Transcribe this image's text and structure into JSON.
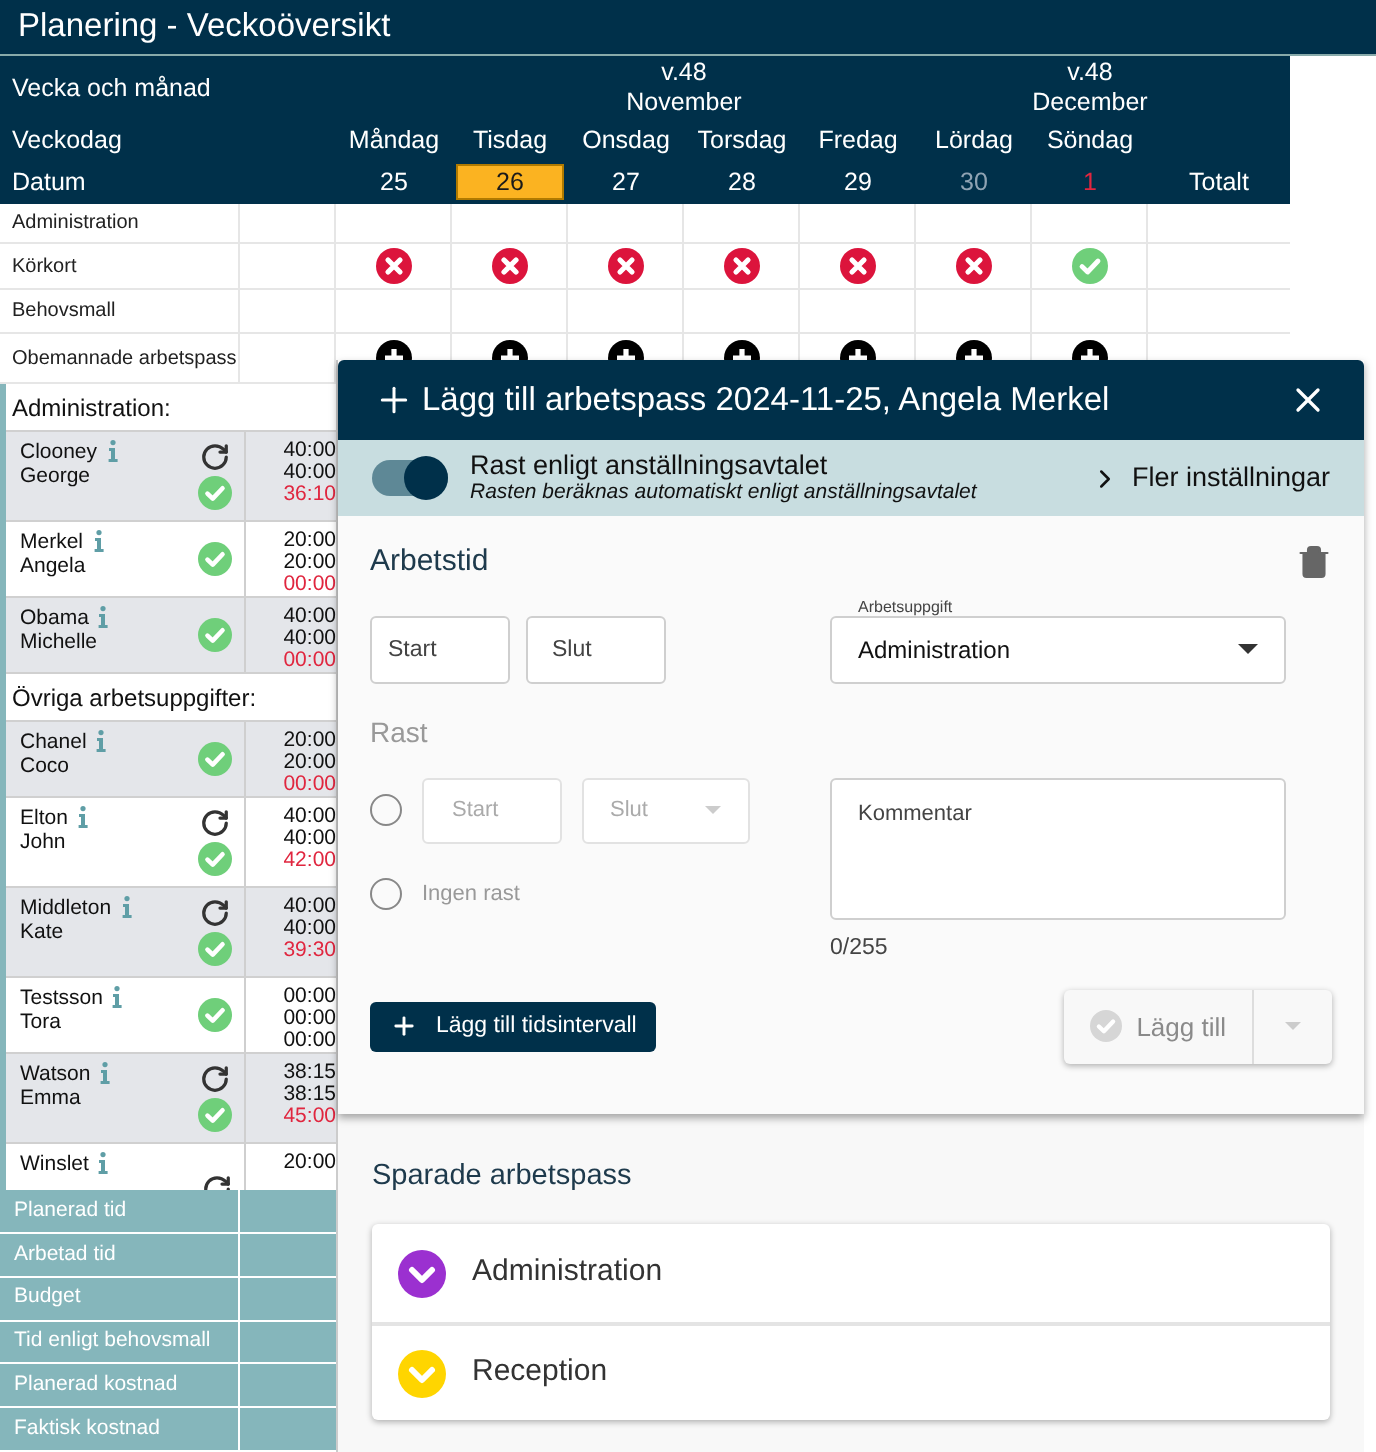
{
  "title": "Planering - Veckoöversikt",
  "table": {
    "header_labels": [
      "Vecka och månad",
      "Veckodag",
      "Datum"
    ],
    "total_label": "Totalt",
    "month_groups": [
      {
        "week": "v.48",
        "month": "November",
        "days": [
          {
            "name": "Måndag",
            "date": "25",
            "kind": "weekday",
            "selected": false
          },
          {
            "name": "Tisdag",
            "date": "26",
            "kind": "weekday",
            "selected": true
          },
          {
            "name": "Onsdag",
            "date": "27",
            "kind": "weekday",
            "selected": false
          },
          {
            "name": "Torsdag",
            "date": "28",
            "kind": "weekday",
            "selected": false
          },
          {
            "name": "Fredag",
            "date": "29",
            "kind": "weekday",
            "selected": false
          },
          {
            "name": "Lördag",
            "date": "30",
            "kind": "saturday",
            "selected": false
          }
        ]
      },
      {
        "week": "v.48",
        "month": "December",
        "days": [
          {
            "name": "Söndag",
            "date": "1",
            "kind": "sunday",
            "selected": false
          }
        ]
      }
    ],
    "summary_rows": [
      {
        "label": "Administration",
        "kind": "empty"
      },
      {
        "label": "Körkort",
        "kind": "status",
        "cells": [
          {
            "ok": false
          },
          {
            "ok": false
          },
          {
            "ok": false
          },
          {
            "ok": false
          },
          {
            "ok": false
          },
          {
            "ok": false
          },
          {
            "ok": true
          }
        ]
      },
      {
        "label": "Behovsmall",
        "kind": "empty"
      },
      {
        "label": "Obemannade arbetspass",
        "kind": "add"
      }
    ],
    "sections": [
      {
        "title": "Administration:",
        "employees": [
          {
            "last": "Clooney",
            "first": "George",
            "repeat": true,
            "approved": true,
            "hours": [
              "40:00",
              "40:00",
              "36:10"
            ],
            "flagged": true
          },
          {
            "last": "Merkel",
            "first": "Angela",
            "repeat": false,
            "approved": true,
            "hours": [
              "20:00",
              "20:00",
              "00:00"
            ],
            "flagged": true
          },
          {
            "last": "Obama",
            "first": "Michelle",
            "repeat": false,
            "approved": true,
            "hours": [
              "40:00",
              "40:00",
              "00:00"
            ],
            "flagged": true
          }
        ]
      },
      {
        "title": "Övriga arbetsuppgifter:",
        "employees": [
          {
            "last": "Chanel",
            "first": "Coco",
            "repeat": false,
            "approved": true,
            "hours": [
              "20:00",
              "20:00",
              "00:00"
            ],
            "flagged": true
          },
          {
            "last": "Elton",
            "first": "John",
            "repeat": true,
            "approved": true,
            "hours": [
              "40:00",
              "40:00",
              "42:00"
            ],
            "flagged": true
          },
          {
            "last": "Middleton",
            "first": "Kate",
            "repeat": true,
            "approved": true,
            "hours": [
              "40:00",
              "40:00",
              "39:30"
            ],
            "flagged": true
          },
          {
            "last": "Testsson",
            "first": "Tora",
            "repeat": false,
            "approved": true,
            "hours": [
              "00:00",
              "00:00",
              "00:00"
            ],
            "flagged": false
          },
          {
            "last": "Watson",
            "first": "Emma",
            "repeat": true,
            "approved": true,
            "hours": [
              "38:15",
              "38:15",
              "45:00"
            ],
            "flagged": true
          },
          {
            "last": "Winslet",
            "repeat": true,
            "hours": [
              "20:00"
            ]
          }
        ]
      }
    ],
    "footer_rows": [
      "Planerad tid",
      "Arbetad tid",
      "Budget",
      "Tid enligt behovsmall",
      "Planerad kostnad",
      "Faktisk kostnad"
    ]
  },
  "dialog": {
    "title": "Lägg till arbetspass 2024-11-25, Angela Merkel",
    "break_rule": {
      "on": true,
      "label": "Rast enligt anställningsavtalet",
      "hint": "Rasten beräknas automatiskt enligt anställningsavtalet"
    },
    "more_settings": "Fler inställningar",
    "worktime_heading": "Arbetstid",
    "start_placeholder": "Start",
    "end_placeholder": "Slut",
    "task": {
      "label": "Arbetsuppgift",
      "value": "Administration"
    },
    "break_heading": "Rast",
    "break_options": [
      {
        "kind": "interval",
        "selected": false,
        "start_placeholder": "Start",
        "end_placeholder": "Slut"
      },
      {
        "kind": "none",
        "selected": false,
        "label": "Ingen rast"
      }
    ],
    "comment": {
      "placeholder": "Kommentar",
      "counter": "0/255"
    },
    "add_interval": "Lägg till tidsintervall",
    "submit": {
      "label": "Lägg till",
      "disabled": true
    },
    "saved_heading": "Sparade arbetspass",
    "saved": [
      {
        "label": "Administration",
        "color": "#9b30d0"
      },
      {
        "label": "Reception",
        "color": "#ffd500"
      }
    ]
  }
}
